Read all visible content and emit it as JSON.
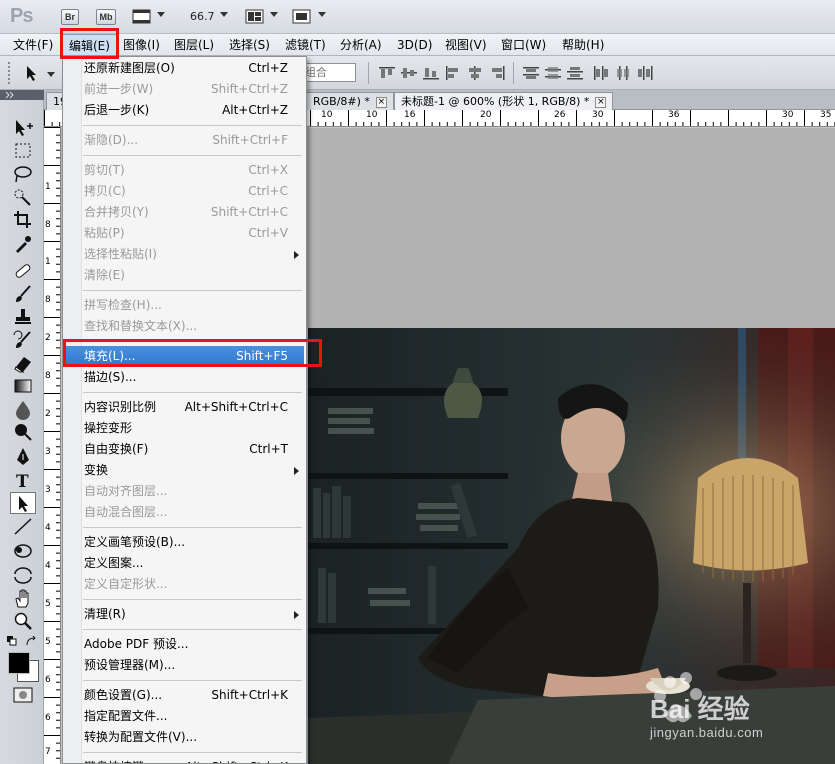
{
  "appbar": {
    "logo": "Ps",
    "bridge_label": "Br",
    "minibridge_label": "Mb",
    "zoom": "66.7"
  },
  "menubar": {
    "items": [
      "文件(F)",
      "编辑(E)",
      "图像(I)",
      "图层(L)",
      "选择(S)",
      "滤镜(T)",
      "分析(A)",
      "3D(D)",
      "视图(V)",
      "窗口(W)",
      "帮助(H)"
    ]
  },
  "options": {
    "combo_text": "组合"
  },
  "tabs": [
    {
      "label": "19"
    },
    {
      "label": "RGB/8#) *"
    },
    {
      "label": "未标题-1 @ 600% (形状 1, RGB/8) *"
    }
  ],
  "ruler": {
    "top": [
      "10",
      "10",
      "16",
      "20",
      "26",
      "30",
      "36",
      "30",
      "35"
    ],
    "left": [
      "1",
      "8",
      "1",
      "8",
      "2",
      "8",
      "2",
      "3",
      "3",
      "4",
      "4",
      "5",
      "5",
      "6",
      "6",
      "7"
    ]
  },
  "edit_menu": {
    "groups": [
      [
        {
          "label": "还原新建图层(O)",
          "shortcut": "Ctrl+Z",
          "disabled": false
        },
        {
          "label": "前进一步(W)",
          "shortcut": "Shift+Ctrl+Z",
          "disabled": true
        },
        {
          "label": "后退一步(K)",
          "shortcut": "Alt+Ctrl+Z",
          "disabled": false
        }
      ],
      [
        {
          "label": "渐隐(D)...",
          "shortcut": "Shift+Ctrl+F",
          "disabled": true
        }
      ],
      [
        {
          "label": "剪切(T)",
          "shortcut": "Ctrl+X",
          "disabled": true
        },
        {
          "label": "拷贝(C)",
          "shortcut": "Ctrl+C",
          "disabled": true
        },
        {
          "label": "合并拷贝(Y)",
          "shortcut": "Shift+Ctrl+C",
          "disabled": true
        },
        {
          "label": "粘贴(P)",
          "shortcut": "Ctrl+V",
          "disabled": true
        },
        {
          "label": "选择性粘贴(I)",
          "shortcut": "",
          "disabled": true,
          "submenu": true
        },
        {
          "label": "清除(E)",
          "shortcut": "",
          "disabled": true
        }
      ],
      [
        {
          "label": "拼写检查(H)...",
          "shortcut": "",
          "disabled": true
        },
        {
          "label": "查找和替换文本(X)...",
          "shortcut": "",
          "disabled": true
        }
      ],
      [
        {
          "label": "填充(L)...",
          "shortcut": "Shift+F5",
          "disabled": false,
          "highlight": true
        },
        {
          "label": "描边(S)...",
          "shortcut": "",
          "disabled": false
        }
      ],
      [
        {
          "label": "内容识别比例",
          "shortcut": "Alt+Shift+Ctrl+C",
          "disabled": false
        },
        {
          "label": "操控变形",
          "shortcut": "",
          "disabled": false
        },
        {
          "label": "自由变换(F)",
          "shortcut": "Ctrl+T",
          "disabled": false
        },
        {
          "label": "变换",
          "shortcut": "",
          "disabled": false,
          "submenu": true
        },
        {
          "label": "自动对齐图层...",
          "shortcut": "",
          "disabled": true
        },
        {
          "label": "自动混合图层...",
          "shortcut": "",
          "disabled": true
        }
      ],
      [
        {
          "label": "定义画笔预设(B)...",
          "shortcut": "",
          "disabled": false
        },
        {
          "label": "定义图案...",
          "shortcut": "",
          "disabled": false
        },
        {
          "label": "定义自定形状...",
          "shortcut": "",
          "disabled": true
        }
      ],
      [
        {
          "label": "清理(R)",
          "shortcut": "",
          "disabled": false,
          "submenu": true
        }
      ],
      [
        {
          "label": "Adobe PDF 预设...",
          "shortcut": "",
          "disabled": false
        },
        {
          "label": "预设管理器(M)...",
          "shortcut": "",
          "disabled": false
        }
      ],
      [
        {
          "label": "颜色设置(G)...",
          "shortcut": "Shift+Ctrl+K",
          "disabled": false
        },
        {
          "label": "指定配置文件...",
          "shortcut": "",
          "disabled": false
        },
        {
          "label": "转换为配置文件(V)...",
          "shortcut": "",
          "disabled": false
        }
      ],
      [
        {
          "label": "键盘快捷键...",
          "shortcut": "Alt+Shift+Ctrl+K",
          "disabled": false
        }
      ]
    ]
  },
  "watermark": {
    "brand": "Bai 经验",
    "url": "jingyan.baidu.com"
  },
  "colors": {
    "highlight": "#3a82d8",
    "annotation_red": "#ee1111",
    "menu_bg": "#f5f5f5"
  }
}
